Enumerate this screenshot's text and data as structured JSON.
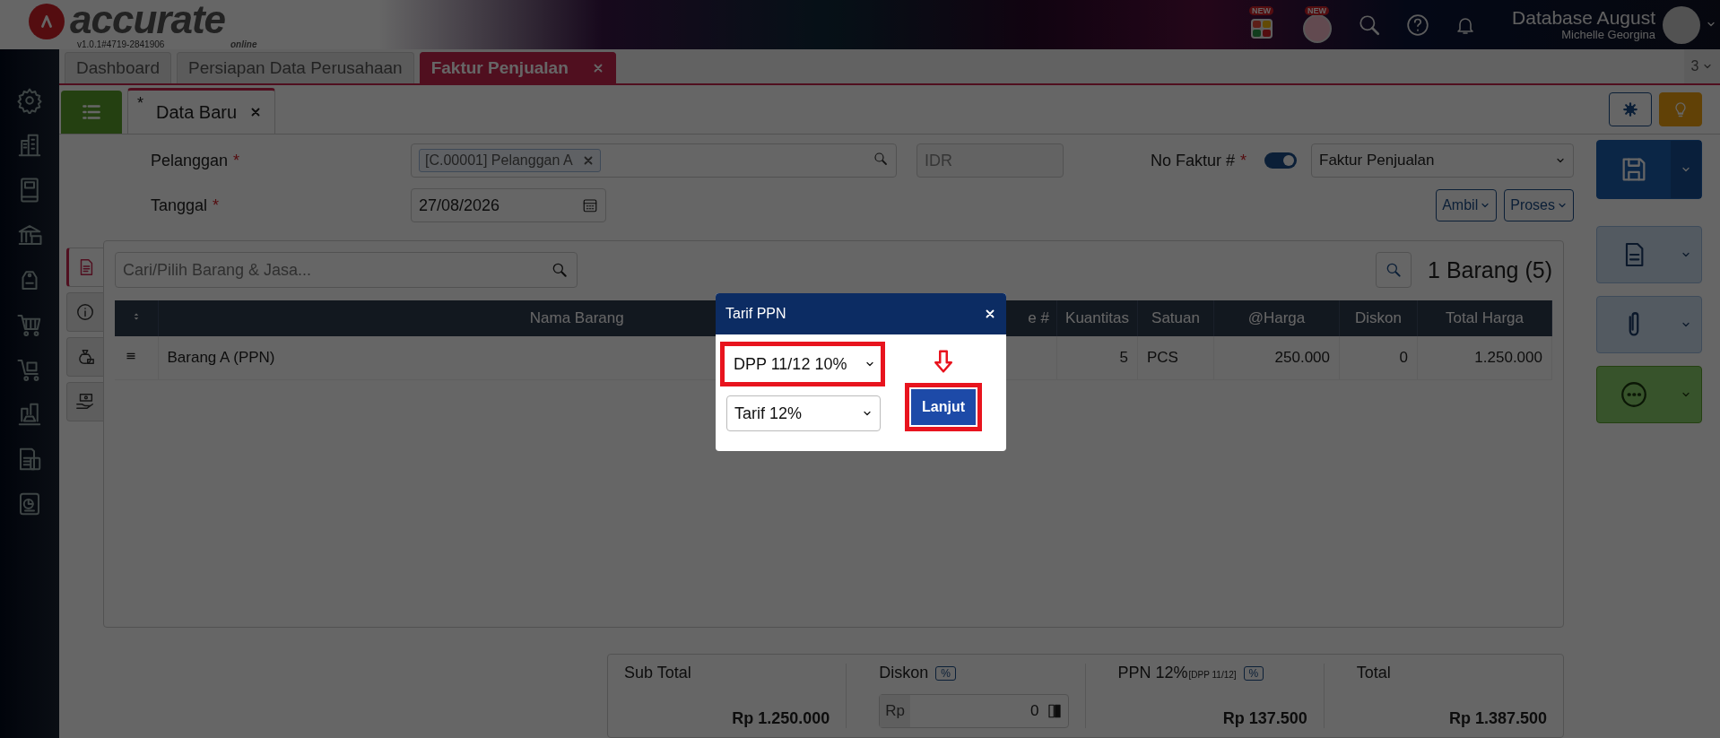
{
  "header": {
    "logo": "accurate",
    "logo_sub": "online",
    "version": "v1.0.1#4719-2841906",
    "badges": [
      "NEW",
      "NEW"
    ],
    "database": "Database August",
    "user": "Michelle Georgina"
  },
  "tabs": [
    {
      "label": "Dashboard",
      "selected": false,
      "closable": false
    },
    {
      "label": "Persiapan Data Perusahaan",
      "selected": false,
      "closable": false
    },
    {
      "label": "Faktur Penjualan",
      "selected": true,
      "closable": true
    }
  ],
  "tab_count": "3",
  "subtabs": [
    {
      "marker": "*",
      "label": "Data Baru",
      "selected": true
    }
  ],
  "form": {
    "customer": {
      "label": "Pelanggan",
      "required": "*",
      "tag": "[C.00001] Pelanggan A"
    },
    "currency": "IDR",
    "date": {
      "label": "Tanggal",
      "required": "*",
      "value": "27/08/2026"
    },
    "invoice_no": {
      "label": "No Faktur #",
      "required": "*",
      "auto": true,
      "type": "Faktur Penjualan"
    },
    "buttons": [
      "Ambil",
      "Proses"
    ]
  },
  "side_tabs": [
    {
      "kind": "document",
      "selected": true
    },
    {
      "kind": "info",
      "selected": false
    },
    {
      "kind": "money",
      "selected": false
    },
    {
      "kind": "payment",
      "selected": false
    }
  ],
  "items": {
    "search_placeholder": "Cari/Pilih Barang & Jasa...",
    "count": "1 Barang (5)",
    "columns": [
      "Nama Barang",
      "e #",
      "Kuantitas",
      "Satuan",
      "@Harga",
      "Diskon",
      "Total Harga"
    ],
    "rows": [
      {
        "cells": [
          "Barang A (PPN)",
          "",
          "5",
          "PCS",
          "250.000",
          "0",
          "1.250.000"
        ]
      }
    ]
  },
  "summary": {
    "subtotal_label": "Sub Total",
    "subtotal": "Rp 1.250.000",
    "discount_label": "Diskon",
    "discount_pct": "%",
    "discount_prefix": "Rp",
    "discount_value": "0",
    "tax_label": "PPN 12%",
    "tax_note": "[DPP 11/12]",
    "tax_pct": "%",
    "tax": "Rp 137.500",
    "total_label": "Total",
    "total": "Rp 1.387.500"
  },
  "dialog": {
    "title": "Tarif PPN",
    "base": "DPP 11/12 10%",
    "rate": "Tarif 12%",
    "button": "Lanjut",
    "highlighted": true
  }
}
